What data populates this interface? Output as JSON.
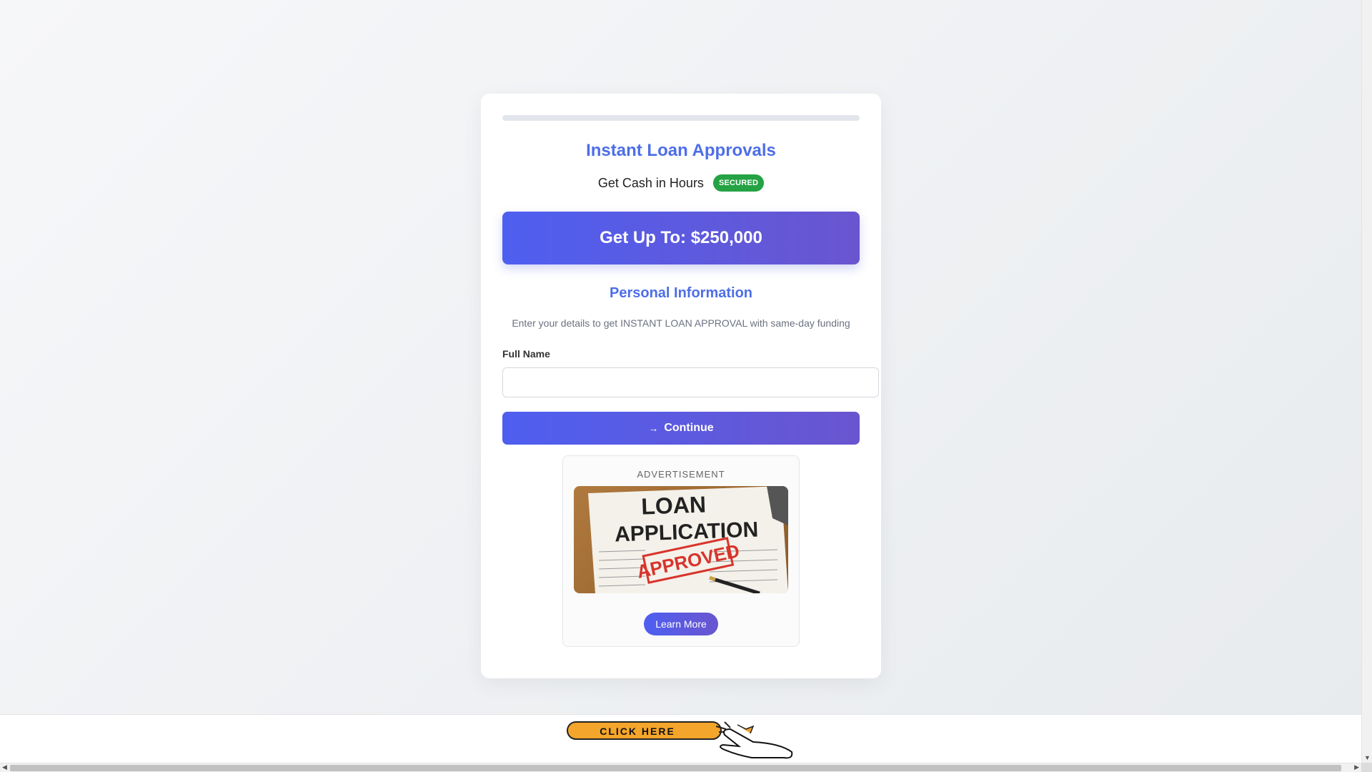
{
  "header": {
    "title": "Instant Loan Approvals",
    "subtitle": "Get Cash in Hours",
    "badge": "SECURED"
  },
  "progress": {
    "value": 0
  },
  "offer": {
    "text": "Get Up To: $250,000"
  },
  "form": {
    "section_title": "Personal Information",
    "description": "Enter your details to get INSTANT LOAN APPROVAL with same-day funding",
    "full_name_label": "Full Name",
    "full_name_value": "",
    "continue_label": "Continue",
    "continue_icon": "arrow-icon"
  },
  "ad": {
    "label": "ADVERTISEMENT",
    "image_text_line1": "LOAN",
    "image_text_line2": "APPLICATION",
    "image_stamp": "APPROVED",
    "cta": "Learn More"
  },
  "bottom_banner": {
    "text": "CLICK HERE"
  },
  "colors": {
    "accent": "#4d6ee8",
    "button_gradient_start": "#4e5ff0",
    "button_gradient_end": "#6a55cf",
    "badge": "#25a244"
  }
}
